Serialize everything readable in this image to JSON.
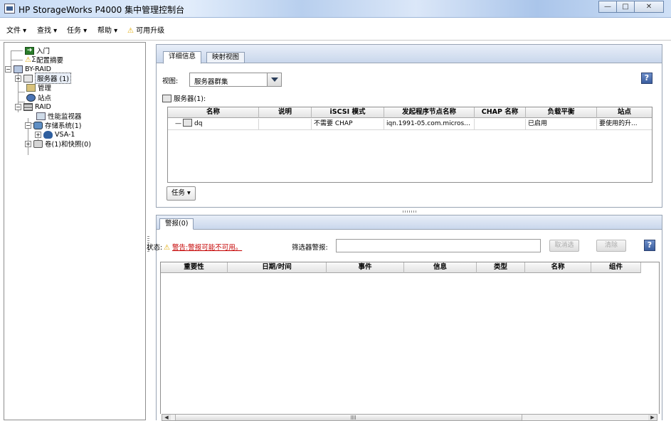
{
  "window": {
    "title": "HP StorageWorks P4000 集中管理控制台",
    "controls": {
      "minimize": "—",
      "maximize": "□",
      "close": "✕"
    }
  },
  "menu": {
    "file": "文件 ▾",
    "find": "查找 ▾",
    "tasks": "任务 ▾",
    "help": "帮助 ▾",
    "upgrades": "可用升级"
  },
  "tree": {
    "getting_started": "入门",
    "config_summary": "配置摘要",
    "management_group": "BY-RAID",
    "servers": "服务器 (1)",
    "administration": "管理",
    "sites": "站点",
    "cluster": "RAID",
    "performance_monitor": "性能监视器",
    "storage_systems": "存储系统(1)",
    "vsa": "VSA-1",
    "volumes": "卷(1)和快照(0)"
  },
  "details": {
    "tabs": [
      "详细信息",
      "映射视图"
    ],
    "view_label": "视图:",
    "view_value": "服务器群集",
    "servers_label": "服务器(1):",
    "columns": [
      "名称",
      "说明",
      "iSCSI 模式",
      "发起程序节点名称",
      "CHAP 名称",
      "负载平衡",
      "站点"
    ],
    "rows": [
      {
        "name": "dq",
        "description": "",
        "iscsi_mode": "不需要 CHAP",
        "initiator": "iqn.1991-05.com.micros...",
        "chap": "",
        "load_balancing": "已启用",
        "site": "要使用的升..."
      }
    ],
    "tasks_button": "任务 ▾",
    "help": "?"
  },
  "alarms": {
    "tab": "警报(0)",
    "status_label": "状态:",
    "status_warning": "警告:警报可能不可用。",
    "filter_label": "筛选器警报:",
    "filter_value": "",
    "select_button": "取消选",
    "clear_button": "清除",
    "help": "?",
    "columns": [
      "重要性",
      "日期/时间",
      "事件",
      "信息",
      "类型",
      "名称",
      "组件"
    ]
  }
}
